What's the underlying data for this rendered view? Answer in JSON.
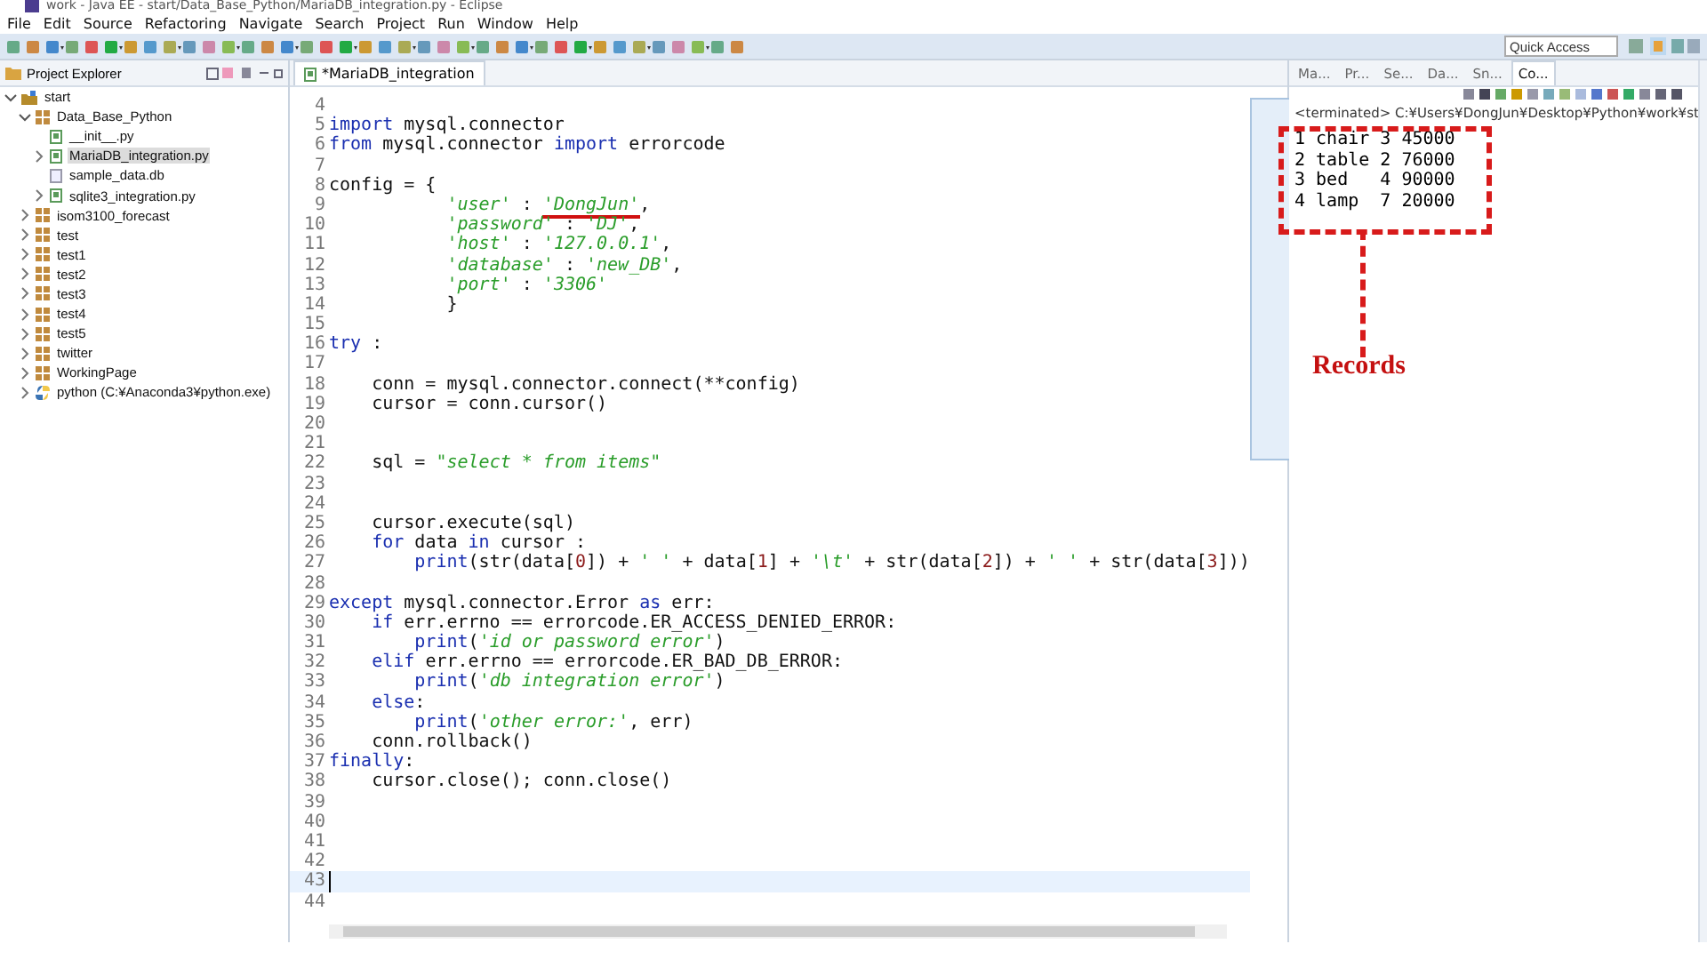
{
  "window": {
    "title": "work - Java EE - start/Data_Base_Python/MariaDB_integration.py - Eclipse"
  },
  "menu": [
    "File",
    "Edit",
    "Source",
    "Refactoring",
    "Navigate",
    "Search",
    "Project",
    "Run",
    "Window",
    "Help"
  ],
  "quick_access": {
    "placeholder": "Quick Access"
  },
  "explorer": {
    "title": "Project Explorer",
    "tree": [
      {
        "label": "start",
        "kind": "project",
        "expanded": true,
        "selected": false,
        "children": [
          {
            "label": "Data_Base_Python",
            "kind": "package",
            "expanded": true,
            "selected": false,
            "children": [
              {
                "label": "__init__.py",
                "kind": "pyfile",
                "selected": false
              },
              {
                "label": "MariaDB_integration.py",
                "kind": "pyfile",
                "expanded": false,
                "selected": true
              },
              {
                "label": "sample_data.db",
                "kind": "dbfile",
                "selected": false
              },
              {
                "label": "sqlite3_integration.py",
                "kind": "pyfile",
                "expanded": false,
                "selected": false
              }
            ]
          },
          {
            "label": "isom3100_forecast",
            "kind": "package",
            "expanded": false,
            "selected": false
          },
          {
            "label": "test",
            "kind": "package",
            "expanded": false,
            "selected": false
          },
          {
            "label": "test1",
            "kind": "package",
            "expanded": false,
            "selected": false
          },
          {
            "label": "test2",
            "kind": "package",
            "expanded": false,
            "selected": false
          },
          {
            "label": "test3",
            "kind": "package",
            "expanded": false,
            "selected": false
          },
          {
            "label": "test4",
            "kind": "package",
            "expanded": false,
            "selected": false
          },
          {
            "label": "test5",
            "kind": "package",
            "expanded": false,
            "selected": false
          },
          {
            "label": "twitter",
            "kind": "package",
            "expanded": false,
            "selected": false
          },
          {
            "label": "WorkingPage",
            "kind": "package",
            "expanded": false,
            "selected": false
          },
          {
            "label": "python  (C:¥Anaconda3¥python.exe)",
            "kind": "interpreter",
            "expanded": false,
            "selected": false
          }
        ]
      }
    ]
  },
  "editor": {
    "tab": {
      "label": "*MariaDB_integration",
      "selected": true
    },
    "lines": [
      {
        "num": "4",
        "current": false
      },
      {
        "num": "5",
        "current": false,
        "tokens": [
          {
            "kind": "kw",
            "text": "import"
          },
          {
            "kind": "plain",
            "text": " mysql.connector"
          }
        ]
      },
      {
        "num": "6",
        "current": false,
        "tokens": [
          {
            "kind": "kw",
            "text": "from"
          },
          {
            "kind": "plain",
            "text": " mysql.connector "
          },
          {
            "kind": "kw",
            "text": "import"
          },
          {
            "kind": "plain",
            "text": " errorcode"
          }
        ]
      },
      {
        "num": "7",
        "current": false
      },
      {
        "num": "8",
        "current": false,
        "tokens": [
          {
            "kind": "plain",
            "text": "config = {"
          }
        ]
      },
      {
        "num": "9",
        "current": false,
        "tokens": [
          {
            "kind": "str",
            "text": "           'user'"
          },
          {
            "kind": "plain",
            "text": " : "
          },
          {
            "kind": "str-marked",
            "text": "'DongJun'"
          },
          {
            "kind": "plain",
            "text": ","
          }
        ]
      },
      {
        "num": "10",
        "current": false,
        "tokens": [
          {
            "kind": "str",
            "text": "           'password'"
          },
          {
            "kind": "plain",
            "text": " : "
          },
          {
            "kind": "str",
            "text": "'DJ'"
          },
          {
            "kind": "plain",
            "text": ","
          }
        ]
      },
      {
        "num": "11",
        "current": false,
        "tokens": [
          {
            "kind": "str",
            "text": "           'host'"
          },
          {
            "kind": "plain",
            "text": " : "
          },
          {
            "kind": "str",
            "text": "'127.0.0.1'"
          },
          {
            "kind": "plain",
            "text": ","
          }
        ]
      },
      {
        "num": "12",
        "current": false,
        "tokens": [
          {
            "kind": "str",
            "text": "           'database'"
          },
          {
            "kind": "plain",
            "text": " : "
          },
          {
            "kind": "str",
            "text": "'new_DB'"
          },
          {
            "kind": "plain",
            "text": ","
          }
        ]
      },
      {
        "num": "13",
        "current": false,
        "tokens": [
          {
            "kind": "str",
            "text": "           'port'"
          },
          {
            "kind": "plain",
            "text": " : "
          },
          {
            "kind": "str",
            "text": "'3306'"
          }
        ]
      },
      {
        "num": "14",
        "current": false,
        "tokens": [
          {
            "kind": "plain",
            "text": "           }"
          }
        ]
      },
      {
        "num": "15",
        "current": false
      },
      {
        "num": "16",
        "current": false,
        "tokens": [
          {
            "kind": "kw",
            "text": "try"
          },
          {
            "kind": "plain",
            "text": " :"
          }
        ]
      },
      {
        "num": "17",
        "current": false
      },
      {
        "num": "18",
        "current": false,
        "tokens": [
          {
            "kind": "plain",
            "text": "    conn = mysql.connector.connect(**config)"
          }
        ]
      },
      {
        "num": "19",
        "current": false,
        "tokens": [
          {
            "kind": "plain",
            "text": "    cursor = conn.cursor()"
          }
        ]
      },
      {
        "num": "20",
        "current": false
      },
      {
        "num": "21",
        "current": false
      },
      {
        "num": "22",
        "current": false,
        "tokens": [
          {
            "kind": "plain",
            "text": "    sql = "
          },
          {
            "kind": "str",
            "text": "\"select * from items\""
          }
        ]
      },
      {
        "num": "23",
        "current": false
      },
      {
        "num": "24",
        "current": false
      },
      {
        "num": "25",
        "current": false,
        "tokens": [
          {
            "kind": "plain",
            "text": "    cursor.execute(sql)"
          }
        ]
      },
      {
        "num": "26",
        "current": false,
        "tokens": [
          {
            "kind": "kw",
            "text": "    for"
          },
          {
            "kind": "plain",
            "text": " data "
          },
          {
            "kind": "kw",
            "text": "in"
          },
          {
            "kind": "plain",
            "text": " cursor :"
          }
        ]
      },
      {
        "num": "27",
        "current": false,
        "tokens": [
          {
            "kind": "kw",
            "text": "        print"
          },
          {
            "kind": "plain",
            "text": "(str(data["
          },
          {
            "kind": "num",
            "text": "0"
          },
          {
            "kind": "plain",
            "text": "]) + "
          },
          {
            "kind": "str",
            "text": "' '"
          },
          {
            "kind": "plain",
            "text": " + data["
          },
          {
            "kind": "num",
            "text": "1"
          },
          {
            "kind": "plain",
            "text": "] + "
          },
          {
            "kind": "str",
            "text": "'\\t'"
          },
          {
            "kind": "plain",
            "text": " + str(data["
          },
          {
            "kind": "num",
            "text": "2"
          },
          {
            "kind": "plain",
            "text": "]) + "
          },
          {
            "kind": "str",
            "text": "' '"
          },
          {
            "kind": "plain",
            "text": " + str(data["
          },
          {
            "kind": "num",
            "text": "3"
          },
          {
            "kind": "plain",
            "text": "]))"
          }
        ]
      },
      {
        "num": "28",
        "current": false
      },
      {
        "num": "29",
        "current": false,
        "tokens": [
          {
            "kind": "kw",
            "text": "except"
          },
          {
            "kind": "plain",
            "text": " mysql.connector.Error "
          },
          {
            "kind": "kw",
            "text": "as"
          },
          {
            "kind": "plain",
            "text": " err:"
          }
        ]
      },
      {
        "num": "30",
        "current": false,
        "tokens": [
          {
            "kind": "kw",
            "text": "    if"
          },
          {
            "kind": "plain",
            "text": " err.errno == errorcode.ER_ACCESS_DENIED_ERROR:"
          }
        ]
      },
      {
        "num": "31",
        "current": false,
        "tokens": [
          {
            "kind": "kw",
            "text": "        print"
          },
          {
            "kind": "plain",
            "text": "("
          },
          {
            "kind": "str",
            "text": "'id or password error'"
          },
          {
            "kind": "plain",
            "text": ")"
          }
        ]
      },
      {
        "num": "32",
        "current": false,
        "tokens": [
          {
            "kind": "kw",
            "text": "    elif"
          },
          {
            "kind": "plain",
            "text": " err.errno == errorcode.ER_BAD_DB_ERROR:"
          }
        ]
      },
      {
        "num": "33",
        "current": false,
        "tokens": [
          {
            "kind": "kw",
            "text": "        print"
          },
          {
            "kind": "plain",
            "text": "("
          },
          {
            "kind": "str",
            "text": "'db integration error'"
          },
          {
            "kind": "plain",
            "text": ")"
          }
        ]
      },
      {
        "num": "34",
        "current": false,
        "tokens": [
          {
            "kind": "kw",
            "text": "    else"
          },
          {
            "kind": "plain",
            "text": ":"
          }
        ]
      },
      {
        "num": "35",
        "current": false,
        "tokens": [
          {
            "kind": "kw",
            "text": "        print"
          },
          {
            "kind": "plain",
            "text": "("
          },
          {
            "kind": "str",
            "text": "'other error:'"
          },
          {
            "kind": "plain",
            "text": ", err)"
          }
        ]
      },
      {
        "num": "36",
        "current": false,
        "tokens": [
          {
            "kind": "plain",
            "text": "    conn.rollback()"
          }
        ]
      },
      {
        "num": "37",
        "current": false,
        "tokens": [
          {
            "kind": "kw",
            "text": "finally"
          },
          {
            "kind": "plain",
            "text": ":"
          }
        ]
      },
      {
        "num": "38",
        "current": false,
        "tokens": [
          {
            "kind": "plain",
            "text": "    cursor.close(); conn.close()"
          }
        ]
      },
      {
        "num": "39",
        "current": false
      },
      {
        "num": "40",
        "current": false
      },
      {
        "num": "41",
        "current": false
      },
      {
        "num": "42",
        "current": false
      },
      {
        "num": "43",
        "current": true
      },
      {
        "num": "44",
        "current": false
      }
    ]
  },
  "console": {
    "tabs": [
      {
        "label": "Ma...",
        "selected": false
      },
      {
        "label": "Pr...",
        "selected": false
      },
      {
        "label": "Se...",
        "selected": false
      },
      {
        "label": "Da...",
        "selected": false
      },
      {
        "label": "Sn...",
        "selected": false
      },
      {
        "label": "Co...",
        "selected": true
      }
    ],
    "header": "<terminated> C:¥Users¥DongJun¥Desktop¥Python¥work¥st",
    "output": [
      "1 chair 3 45000",
      "2 table 2 76000",
      "3 bed   4 90000",
      "4 lamp  7 20000"
    ],
    "annotation": "Records"
  }
}
